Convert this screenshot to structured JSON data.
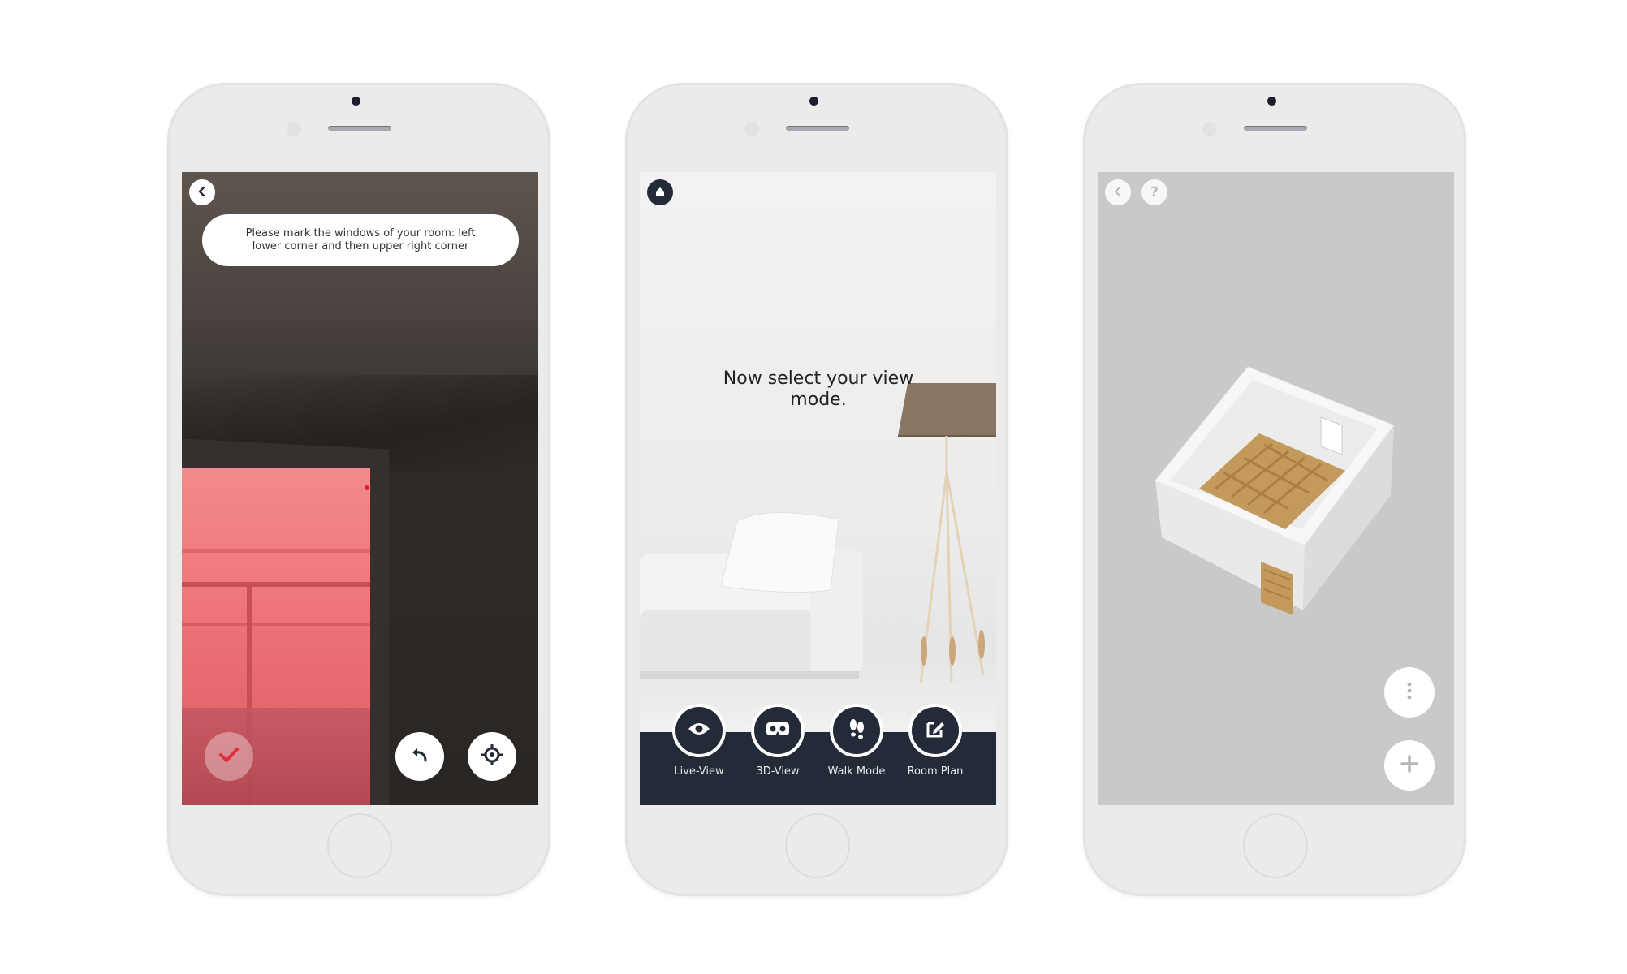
{
  "screen1": {
    "hint": "Please mark the windows of your room: left lower corner and then upper right corner",
    "icons": {
      "back": "chevron-left-icon",
      "confirm": "check-icon",
      "undo": "undo-arrow-icon",
      "target": "crosshair-icon"
    }
  },
  "screen2": {
    "headline": "Now select your view mode.",
    "modes": [
      {
        "label": "Live-View",
        "icon": "eye-icon"
      },
      {
        "label": "3D-View",
        "icon": "vr-headset-icon"
      },
      {
        "label": "Walk Mode",
        "icon": "footsteps-icon"
      },
      {
        "label": "Room Plan",
        "icon": "edit-icon"
      }
    ],
    "icons": {
      "home": "home-icon"
    }
  },
  "screen3": {
    "help_label": "?",
    "icons": {
      "back": "chevron-left-icon",
      "help": "question-icon",
      "more": "more-vertical-icon",
      "add": "plus-icon"
    }
  },
  "colors": {
    "dark_bar": "#232a38",
    "overlay_pink": "#f07b7e",
    "plan_bg": "#c9c9c9",
    "phone_body": "#ebebeb"
  }
}
